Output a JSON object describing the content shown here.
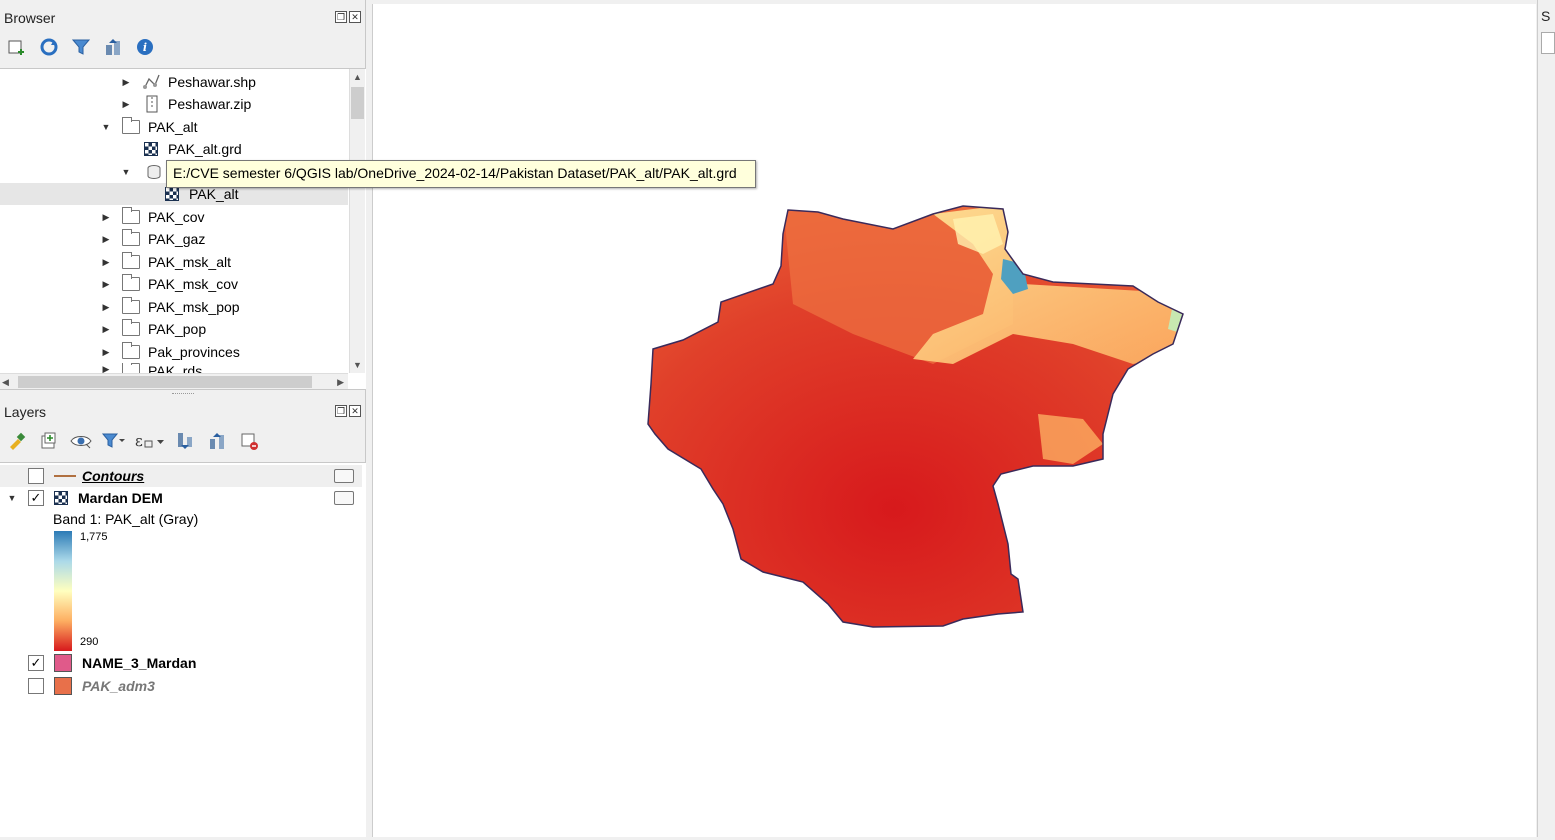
{
  "browser": {
    "title": "Browser",
    "items": [
      {
        "label": "Peshawar.shp",
        "icon": "vector-file-icon"
      },
      {
        "label": "Peshawar.zip",
        "icon": "zip-file-icon"
      },
      {
        "label": "PAK_alt",
        "icon": "folder-icon"
      },
      {
        "label": "PAK_alt.grd",
        "icon": "raster-icon"
      },
      {
        "label": "PAK_alt",
        "icon": "raster-icon"
      },
      {
        "label": "PAK_cov",
        "icon": "folder-icon"
      },
      {
        "label": "PAK_gaz",
        "icon": "folder-icon"
      },
      {
        "label": "PAK_msk_alt",
        "icon": "folder-icon"
      },
      {
        "label": "PAK_msk_cov",
        "icon": "folder-icon"
      },
      {
        "label": "PAK_msk_pop",
        "icon": "folder-icon"
      },
      {
        "label": "PAK_pop",
        "icon": "folder-icon"
      },
      {
        "label": "Pak_provinces",
        "icon": "folder-icon"
      },
      {
        "label": "PAK_rds",
        "icon": "folder-icon"
      }
    ],
    "tooltip": "E:/CVE semester 6/QGIS lab/OneDrive_2024-02-14/Pakistan Dataset/PAK_alt/PAK_alt.grd"
  },
  "layers": {
    "title": "Layers",
    "items": [
      {
        "label": "Contours",
        "checked": false
      },
      {
        "label": "Mardan DEM",
        "checked": true
      },
      {
        "label": "NAME_3_Mardan",
        "checked": true,
        "color": "#e05a8a"
      },
      {
        "label": "PAK_adm3",
        "checked": false,
        "color": "#e8704a"
      }
    ],
    "band_label": "Band 1: PAK_alt (Gray)",
    "ramp_max": "1,775",
    "ramp_min": "290"
  },
  "colors": {
    "dem_low": "#d7191c",
    "dem_mid": "#fdae61",
    "dem_high": "#2c7bb6",
    "boundary": "#e05a8a"
  }
}
